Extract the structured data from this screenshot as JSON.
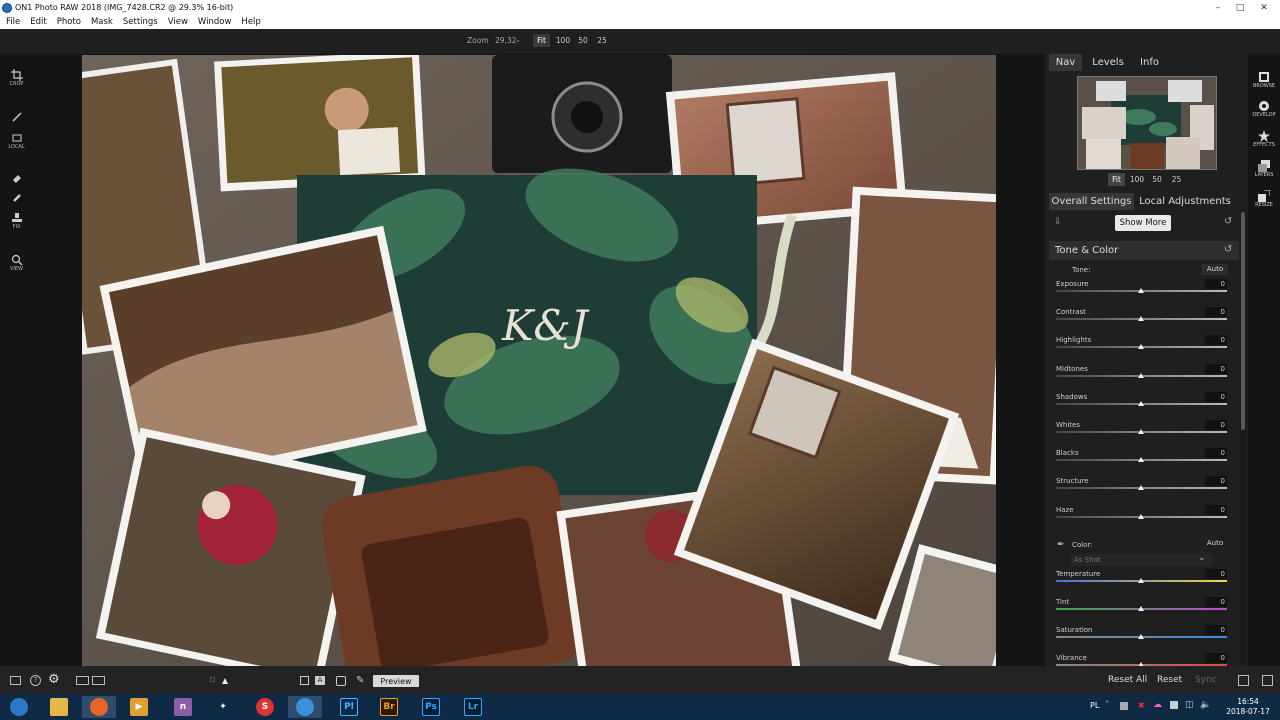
{
  "window": {
    "title": "ON1 Photo RAW 2018 (IMG_7428.CR2 @ 29.3% 16-bit)"
  },
  "menu": [
    "File",
    "Edit",
    "Photo",
    "Mask",
    "Settings",
    "View",
    "Window",
    "Help"
  ],
  "zoom": {
    "label": "Zoom",
    "value": "29,32",
    "buttons": [
      "Fit",
      "100",
      "50",
      "25"
    ],
    "active": "Fit"
  },
  "left_tools": [
    {
      "icon": "crop-icon",
      "label": "CROP"
    },
    {
      "icon": "brush-icon",
      "label": ""
    },
    {
      "icon": "local-icon",
      "label": "LOCAL"
    },
    {
      "icon": "eraser-icon",
      "label": ""
    },
    {
      "icon": "healing-icon",
      "label": ""
    },
    {
      "icon": "stamp-icon",
      "label": "FIX"
    },
    {
      "icon": "magnifier-icon",
      "label": "VIEW"
    }
  ],
  "panel": {
    "top_tabs": [
      "Nav",
      "Levels",
      "Info"
    ],
    "active_top_tab": "Nav",
    "nav_zoom_buttons": [
      "Fit",
      "100",
      "50",
      "25"
    ],
    "sub_tabs": [
      "Overall Settings",
      "Local Adjustments"
    ],
    "active_sub_tab": "Overall Settings",
    "show_more": "Show More",
    "section": "Tone & Color",
    "tone_label": "Tone:",
    "tone_auto": "Auto",
    "tone_sliders": [
      {
        "name": "Exposure",
        "value": "0"
      },
      {
        "name": "Contrast",
        "value": "0"
      },
      {
        "name": "Highlights",
        "value": "0"
      },
      {
        "name": "Midtones",
        "value": "0"
      },
      {
        "name": "Shadows",
        "value": "0"
      },
      {
        "name": "Whites",
        "value": "0"
      },
      {
        "name": "Blacks",
        "value": "0"
      },
      {
        "name": "Structure",
        "value": "0"
      },
      {
        "name": "Haze",
        "value": "0"
      }
    ],
    "color_label": "Color:",
    "color_auto": "Auto",
    "white_balance": "As Shot",
    "color_sliders": [
      {
        "name": "Temperature",
        "value": "0"
      },
      {
        "name": "Tint",
        "value": "0"
      },
      {
        "name": "Saturation",
        "value": "0"
      },
      {
        "name": "Vibrance",
        "value": "0"
      }
    ]
  },
  "modules": [
    {
      "icon": "browse-icon",
      "label": "BROWSE"
    },
    {
      "icon": "develop-icon",
      "label": "DEVELOP"
    },
    {
      "icon": "effects-icon",
      "label": "EFFECTS"
    },
    {
      "icon": "layers-icon",
      "label": "LAYERS"
    },
    {
      "icon": "resize-icon",
      "label": "RESIZE"
    }
  ],
  "bottom": {
    "preview": "Preview",
    "reset_all": "Reset All",
    "reset": "Reset",
    "sync": "Sync"
  },
  "taskbar": {
    "apps": [
      "Pl",
      "Br",
      "Ps",
      "Lr"
    ],
    "language": "PL",
    "time": "16:54",
    "date": "2018-07-17"
  },
  "colors": {
    "accent_blue": "#2a6fb5",
    "panel_bg": "#1f1f1f",
    "taskbar_bg": "#0f2a44"
  }
}
